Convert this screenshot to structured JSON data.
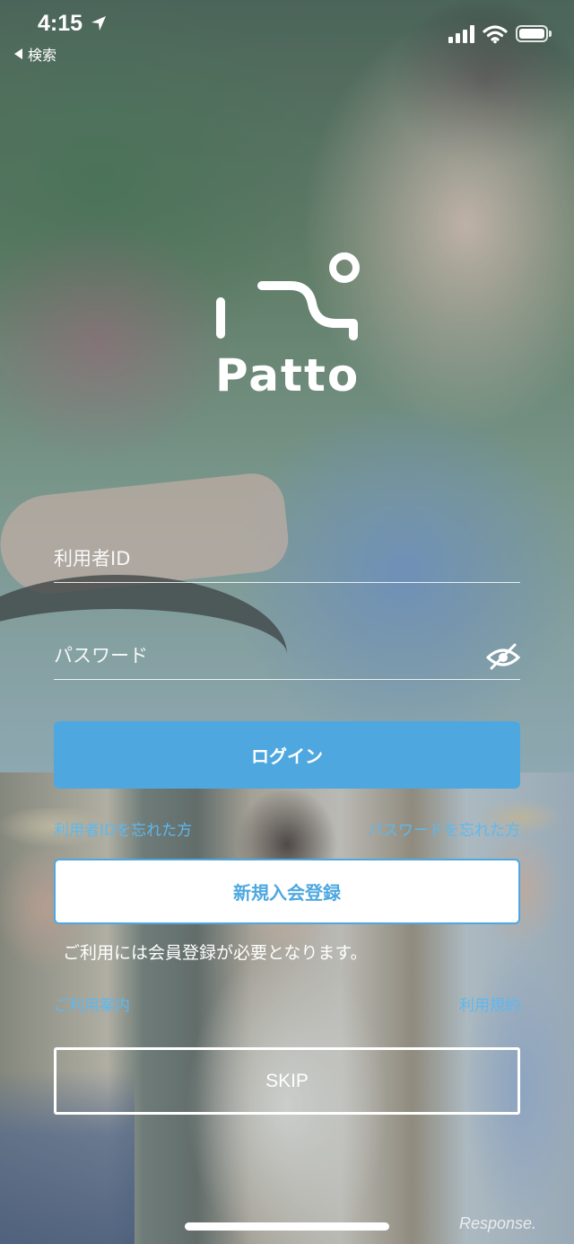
{
  "status_bar": {
    "time": "4:15",
    "back_label": "検索"
  },
  "app": {
    "logo_text": "Patto"
  },
  "form": {
    "user_id_placeholder": "利用者ID",
    "password_placeholder": "パスワード"
  },
  "actions": {
    "login_label": "ログイン",
    "forgot_id_label": "利用者IDを忘れた方",
    "forgot_password_label": "パスワードを忘れた方",
    "register_label": "新規入会登録",
    "registration_note": "ご利用には会員登録が必要となります。",
    "guide_label": "ご利用案内",
    "terms_label": "利用規約",
    "skip_label": "SKIP"
  },
  "watermark": "Response.",
  "colors": {
    "accent": "#4ea8df",
    "link": "#5db8ef",
    "text_on_photo": "#ffffff"
  },
  "icons": {
    "status": [
      "location-arrow-icon",
      "signal-icon",
      "wifi-icon",
      "battery-icon"
    ],
    "password_toggle": "eye-slash-icon",
    "back": "back-triangle-icon"
  }
}
